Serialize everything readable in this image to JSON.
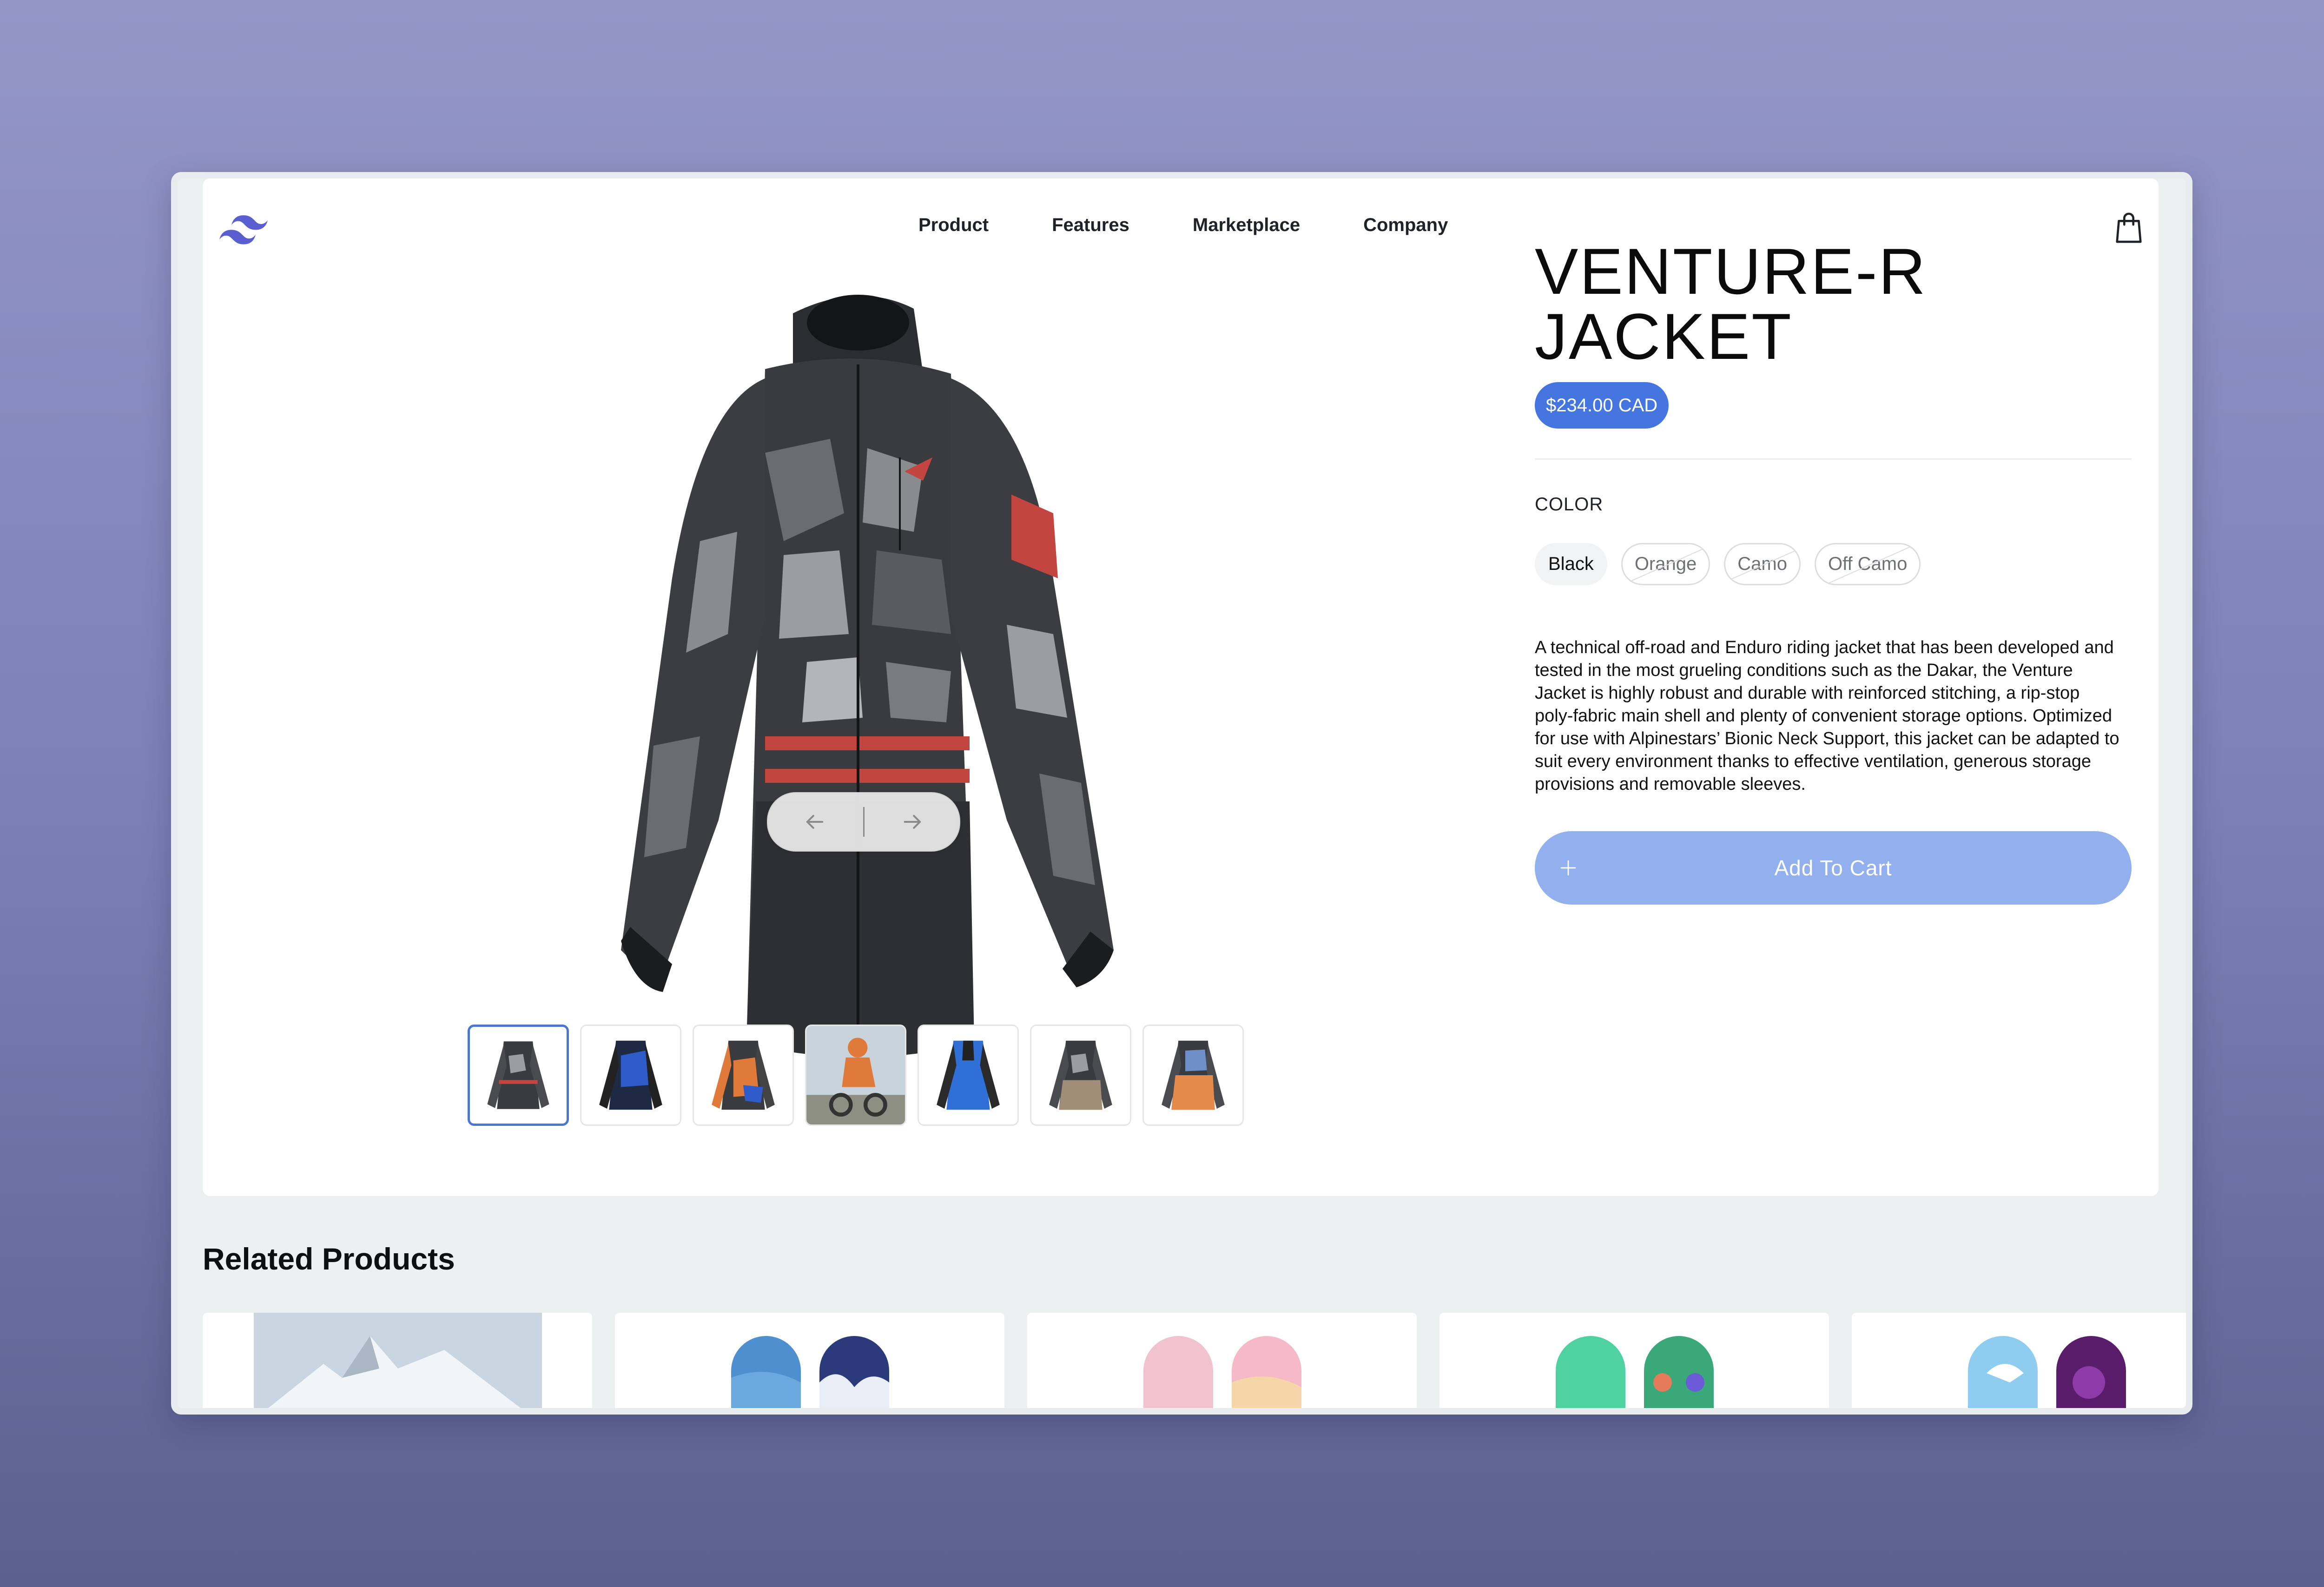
{
  "nav": {
    "items": [
      "Product",
      "Features",
      "Marketplace",
      "Company"
    ]
  },
  "product": {
    "title": "VENTURE-R JACKET",
    "price": "$234.00 CAD",
    "color_label": "COLOR",
    "colors": [
      {
        "label": "Black",
        "state": "selected"
      },
      {
        "label": "Orange",
        "state": "unavailable"
      },
      {
        "label": "Camo",
        "state": "unavailable"
      },
      {
        "label": "Off Camo",
        "state": "unavailable"
      }
    ],
    "description": "A technical off-road and Enduro riding jacket that has been developed and tested in the most grueling conditions such as the Dakar, the Venture Jacket is highly robust and durable with reinforced stitching, a rip-stop poly-fabric main shell and plenty of convenient storage options. Optimized for use with Alpinestars’ Bionic Neck Support, this jacket can be adapted to suit every environment thanks to effective ventilation, generous storage provisions and removable sleeves.",
    "add_to_cart_label": "Add To Cart",
    "thumbnails": [
      {
        "variant": "black-camo",
        "selected": true
      },
      {
        "variant": "blue-black",
        "selected": false
      },
      {
        "variant": "orange-blue",
        "selected": false
      },
      {
        "variant": "rider-photo",
        "selected": false
      },
      {
        "variant": "blue",
        "selected": false
      },
      {
        "variant": "tan-camo",
        "selected": false
      },
      {
        "variant": "orange-camo",
        "selected": false
      }
    ]
  },
  "related": {
    "title": "Related Products",
    "items": [
      {
        "image": "mountain-photo"
      },
      {
        "image": "blue-snowboards"
      },
      {
        "image": "pink-snowboards"
      },
      {
        "image": "green-snowboards"
      },
      {
        "image": "purple-snowboards"
      }
    ]
  },
  "colors": {
    "accent": "#4576e0",
    "button": "#92b0ee",
    "logo": "#5a5fd0",
    "background_top": "#9496c8",
    "background_bottom": "#5b6090"
  },
  "icons": {
    "logo": "tailwind-logo-icon",
    "cart": "shopping-bag-icon",
    "prev": "arrow-left-icon",
    "next": "arrow-right-icon",
    "add": "plus-icon"
  }
}
